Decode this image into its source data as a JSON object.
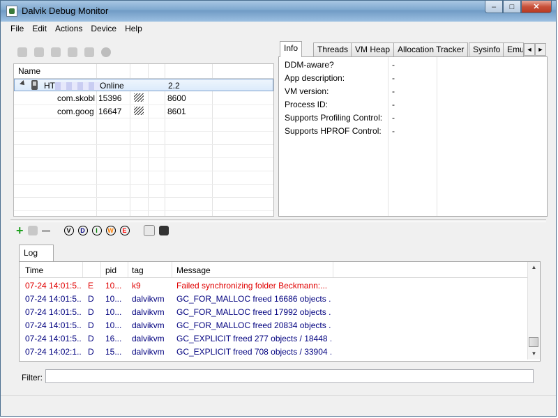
{
  "window": {
    "title": "Dalvik Debug Monitor",
    "min_label": "–",
    "max_label": "□",
    "close_label": "✕"
  },
  "menu": [
    {
      "label": "File"
    },
    {
      "label": "Edit"
    },
    {
      "label": "Actions"
    },
    {
      "label": "Device"
    },
    {
      "label": "Help"
    }
  ],
  "devices": {
    "header": "Name",
    "device": {
      "name": "HT",
      "status": "Online",
      "version": "2.2"
    },
    "clients": [
      {
        "name": "com.skobl",
        "pid": "15396",
        "port": "8600",
        "icon": "bug-icon"
      },
      {
        "name": "com.goog",
        "pid": "16647",
        "port": "8601",
        "icon": "bug-icon"
      }
    ]
  },
  "info_tabs": [
    {
      "label": "Info",
      "active": true
    },
    {
      "label": "Threads"
    },
    {
      "label": "VM Heap"
    },
    {
      "label": "Allocation Tracker"
    },
    {
      "label": "Sysinfo"
    },
    {
      "label": "Emu"
    }
  ],
  "info_nav": {
    "left": "◄",
    "right": "►"
  },
  "info_rows": [
    {
      "label": "DDM-aware?",
      "value": "-"
    },
    {
      "label": "App description:",
      "value": "-"
    },
    {
      "label": "VM version:",
      "value": "-"
    },
    {
      "label": "Process ID:",
      "value": "-"
    },
    {
      "label": "Supports Profiling Control:",
      "value": "-"
    },
    {
      "label": "Supports HPROF Control:",
      "value": "-"
    }
  ],
  "log_levels": [
    {
      "letter": "V",
      "color": "#000000"
    },
    {
      "letter": "D",
      "color": "#00007f"
    },
    {
      "letter": "I",
      "color": "#007f00"
    },
    {
      "letter": "W",
      "color": "#ff7f00"
    },
    {
      "letter": "E",
      "color": "#ff0000"
    }
  ],
  "log": {
    "tab": "Log",
    "columns": [
      "Time",
      "",
      "pid",
      "tag",
      "Message"
    ],
    "rows": [
      {
        "time": "07-24 14:01:5...",
        "level": "E",
        "pid": "10...",
        "tag": "k9",
        "message": "Failed synchronizing folder Beckmann:...",
        "color": "#e00000"
      },
      {
        "time": "07-24 14:01:5...",
        "level": "D",
        "pid": "10...",
        "tag": "dalvikvm",
        "message": "GC_FOR_MALLOC freed 16686 objects ...",
        "color": "#00007f"
      },
      {
        "time": "07-24 14:01:5...",
        "level": "D",
        "pid": "10...",
        "tag": "dalvikvm",
        "message": "GC_FOR_MALLOC freed 17992 objects ...",
        "color": "#00007f"
      },
      {
        "time": "07-24 14:01:5...",
        "level": "D",
        "pid": "10...",
        "tag": "dalvikvm",
        "message": "GC_FOR_MALLOC freed 20834 objects ...",
        "color": "#00007f"
      },
      {
        "time": "07-24 14:01:5...",
        "level": "D",
        "pid": "16...",
        "tag": "dalvikvm",
        "message": "GC_EXPLICIT freed 277 objects / 18448 ...",
        "color": "#00007f"
      },
      {
        "time": "07-24 14:02:1...",
        "level": "D",
        "pid": "15...",
        "tag": "dalvikvm",
        "message": "GC_EXPLICIT freed 708 objects / 33904 ...",
        "color": "#00007f"
      }
    ]
  },
  "scroll": {
    "up": "▲",
    "down": "▼"
  },
  "filter": {
    "label": "Filter:",
    "value": ""
  }
}
